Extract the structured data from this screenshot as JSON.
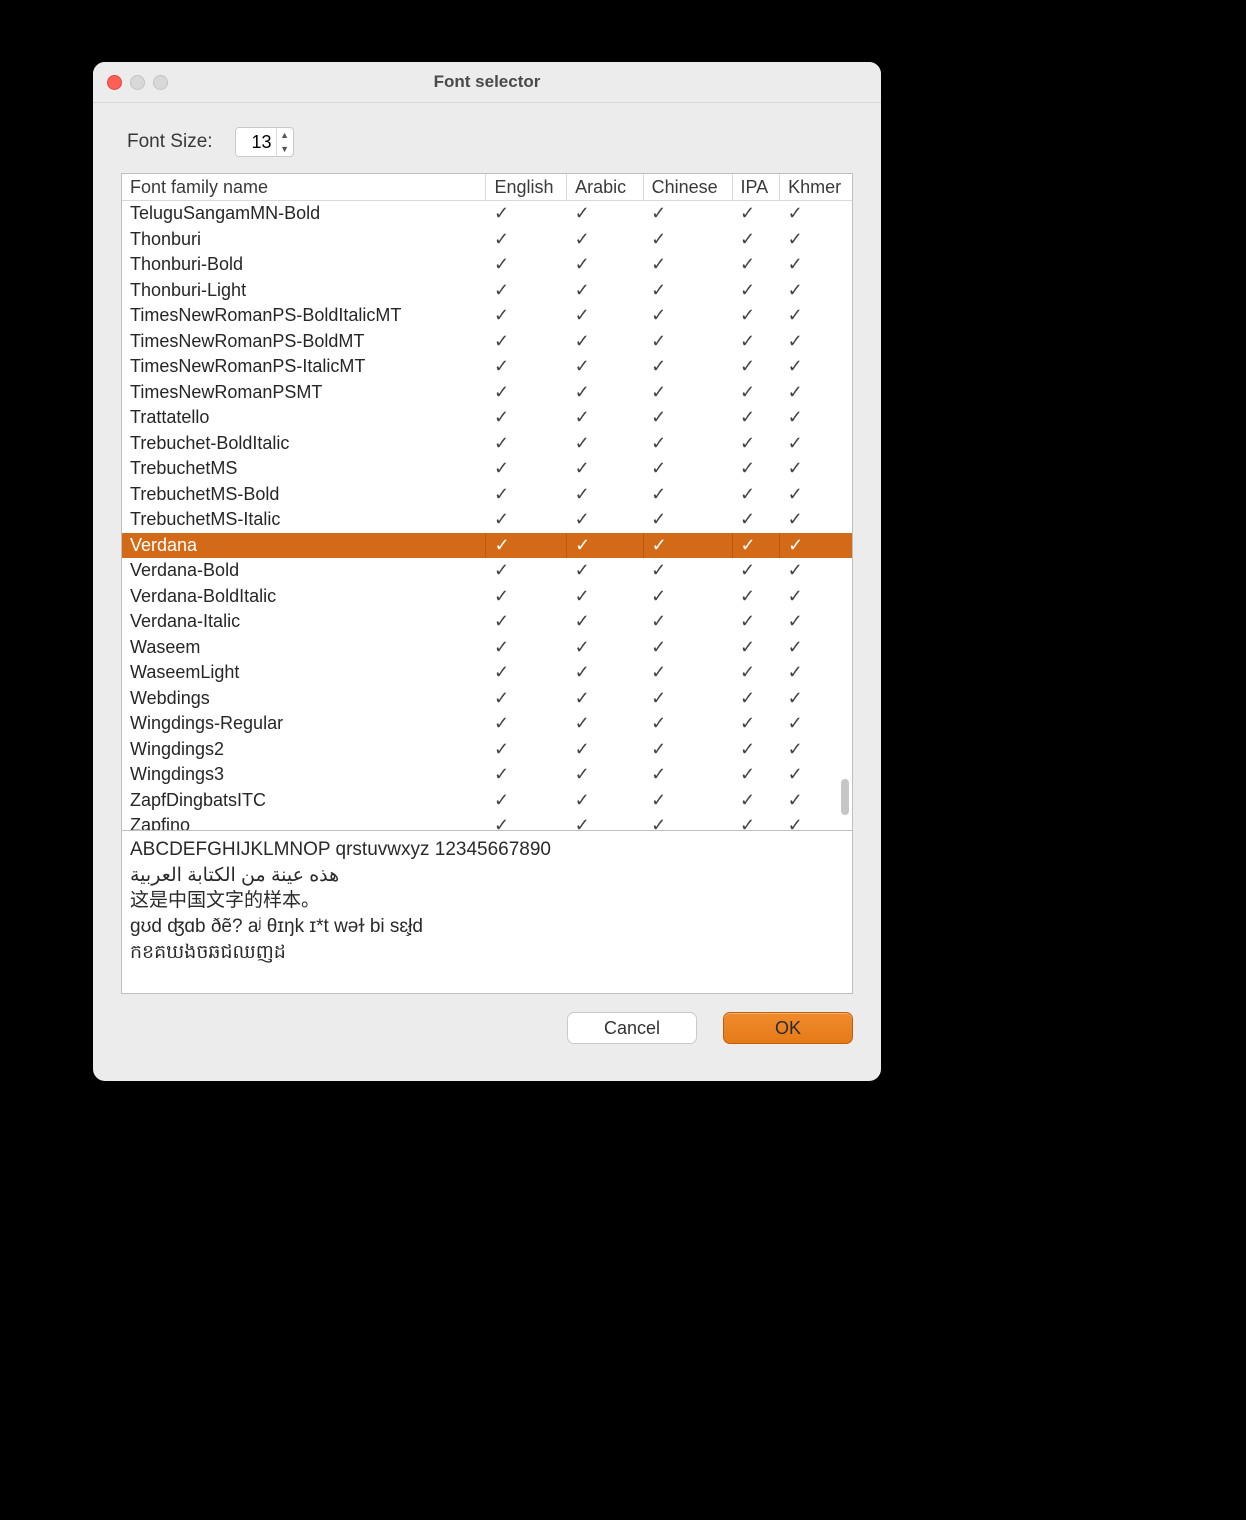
{
  "window": {
    "title": "Font selector"
  },
  "font_size": {
    "label": "Font Size:",
    "value": "13"
  },
  "columns": {
    "name": "Font family name",
    "english": "English",
    "arabic": "Arabic",
    "chinese": "Chinese",
    "ipa": "IPA",
    "khmer": "Khmer"
  },
  "check_glyph": "✓",
  "rows": [
    {
      "name": "TeluguSangamMN-Bold",
      "en": true,
      "ar": true,
      "cn": true,
      "ipa": true,
      "km": true,
      "selected": false
    },
    {
      "name": "Thonburi",
      "en": true,
      "ar": true,
      "cn": true,
      "ipa": true,
      "km": true,
      "selected": false
    },
    {
      "name": "Thonburi-Bold",
      "en": true,
      "ar": true,
      "cn": true,
      "ipa": true,
      "km": true,
      "selected": false
    },
    {
      "name": "Thonburi-Light",
      "en": true,
      "ar": true,
      "cn": true,
      "ipa": true,
      "km": true,
      "selected": false
    },
    {
      "name": "TimesNewRomanPS-BoldItalicMT",
      "en": true,
      "ar": true,
      "cn": true,
      "ipa": true,
      "km": true,
      "selected": false
    },
    {
      "name": "TimesNewRomanPS-BoldMT",
      "en": true,
      "ar": true,
      "cn": true,
      "ipa": true,
      "km": true,
      "selected": false
    },
    {
      "name": "TimesNewRomanPS-ItalicMT",
      "en": true,
      "ar": true,
      "cn": true,
      "ipa": true,
      "km": true,
      "selected": false
    },
    {
      "name": "TimesNewRomanPSMT",
      "en": true,
      "ar": true,
      "cn": true,
      "ipa": true,
      "km": true,
      "selected": false
    },
    {
      "name": "Trattatello",
      "en": true,
      "ar": true,
      "cn": true,
      "ipa": true,
      "km": true,
      "selected": false
    },
    {
      "name": "Trebuchet-BoldItalic",
      "en": true,
      "ar": true,
      "cn": true,
      "ipa": true,
      "km": true,
      "selected": false
    },
    {
      "name": "TrebuchetMS",
      "en": true,
      "ar": true,
      "cn": true,
      "ipa": true,
      "km": true,
      "selected": false
    },
    {
      "name": "TrebuchetMS-Bold",
      "en": true,
      "ar": true,
      "cn": true,
      "ipa": true,
      "km": true,
      "selected": false
    },
    {
      "name": "TrebuchetMS-Italic",
      "en": true,
      "ar": true,
      "cn": true,
      "ipa": true,
      "km": true,
      "selected": false
    },
    {
      "name": "Verdana",
      "en": true,
      "ar": true,
      "cn": true,
      "ipa": true,
      "km": true,
      "selected": true
    },
    {
      "name": "Verdana-Bold",
      "en": true,
      "ar": true,
      "cn": true,
      "ipa": true,
      "km": true,
      "selected": false
    },
    {
      "name": "Verdana-BoldItalic",
      "en": true,
      "ar": true,
      "cn": true,
      "ipa": true,
      "km": true,
      "selected": false
    },
    {
      "name": "Verdana-Italic",
      "en": true,
      "ar": true,
      "cn": true,
      "ipa": true,
      "km": true,
      "selected": false
    },
    {
      "name": "Waseem",
      "en": true,
      "ar": true,
      "cn": true,
      "ipa": true,
      "km": true,
      "selected": false
    },
    {
      "name": "WaseemLight",
      "en": true,
      "ar": true,
      "cn": true,
      "ipa": true,
      "km": true,
      "selected": false
    },
    {
      "name": "Webdings",
      "en": true,
      "ar": true,
      "cn": true,
      "ipa": true,
      "km": true,
      "selected": false
    },
    {
      "name": "Wingdings-Regular",
      "en": true,
      "ar": true,
      "cn": true,
      "ipa": true,
      "km": true,
      "selected": false
    },
    {
      "name": "Wingdings2",
      "en": true,
      "ar": true,
      "cn": true,
      "ipa": true,
      "km": true,
      "selected": false
    },
    {
      "name": "Wingdings3",
      "en": true,
      "ar": true,
      "cn": true,
      "ipa": true,
      "km": true,
      "selected": false
    },
    {
      "name": "ZapfDingbatsITC",
      "en": true,
      "ar": true,
      "cn": true,
      "ipa": true,
      "km": true,
      "selected": false
    },
    {
      "name": "Zapfino",
      "en": true,
      "ar": true,
      "cn": true,
      "ipa": true,
      "km": true,
      "selected": false
    }
  ],
  "preview": {
    "latin": "ABCDEFGHIJKLMNOP qrstuvwxyz 12345667890",
    "arabic": "هذه عينة من الكتابة العربية",
    "chinese": "这是中国文字的样本。",
    "ipa": "ɡʊd ʤɑb ðẽ? aʲ θɪŋk ɪ*t wəɫ bi sɛ̧ł̣d",
    "khmer": "កខគឃងចឆជឈញដ"
  },
  "buttons": {
    "cancel": "Cancel",
    "ok": "OK"
  },
  "colors": {
    "accent": "#d36a17"
  }
}
